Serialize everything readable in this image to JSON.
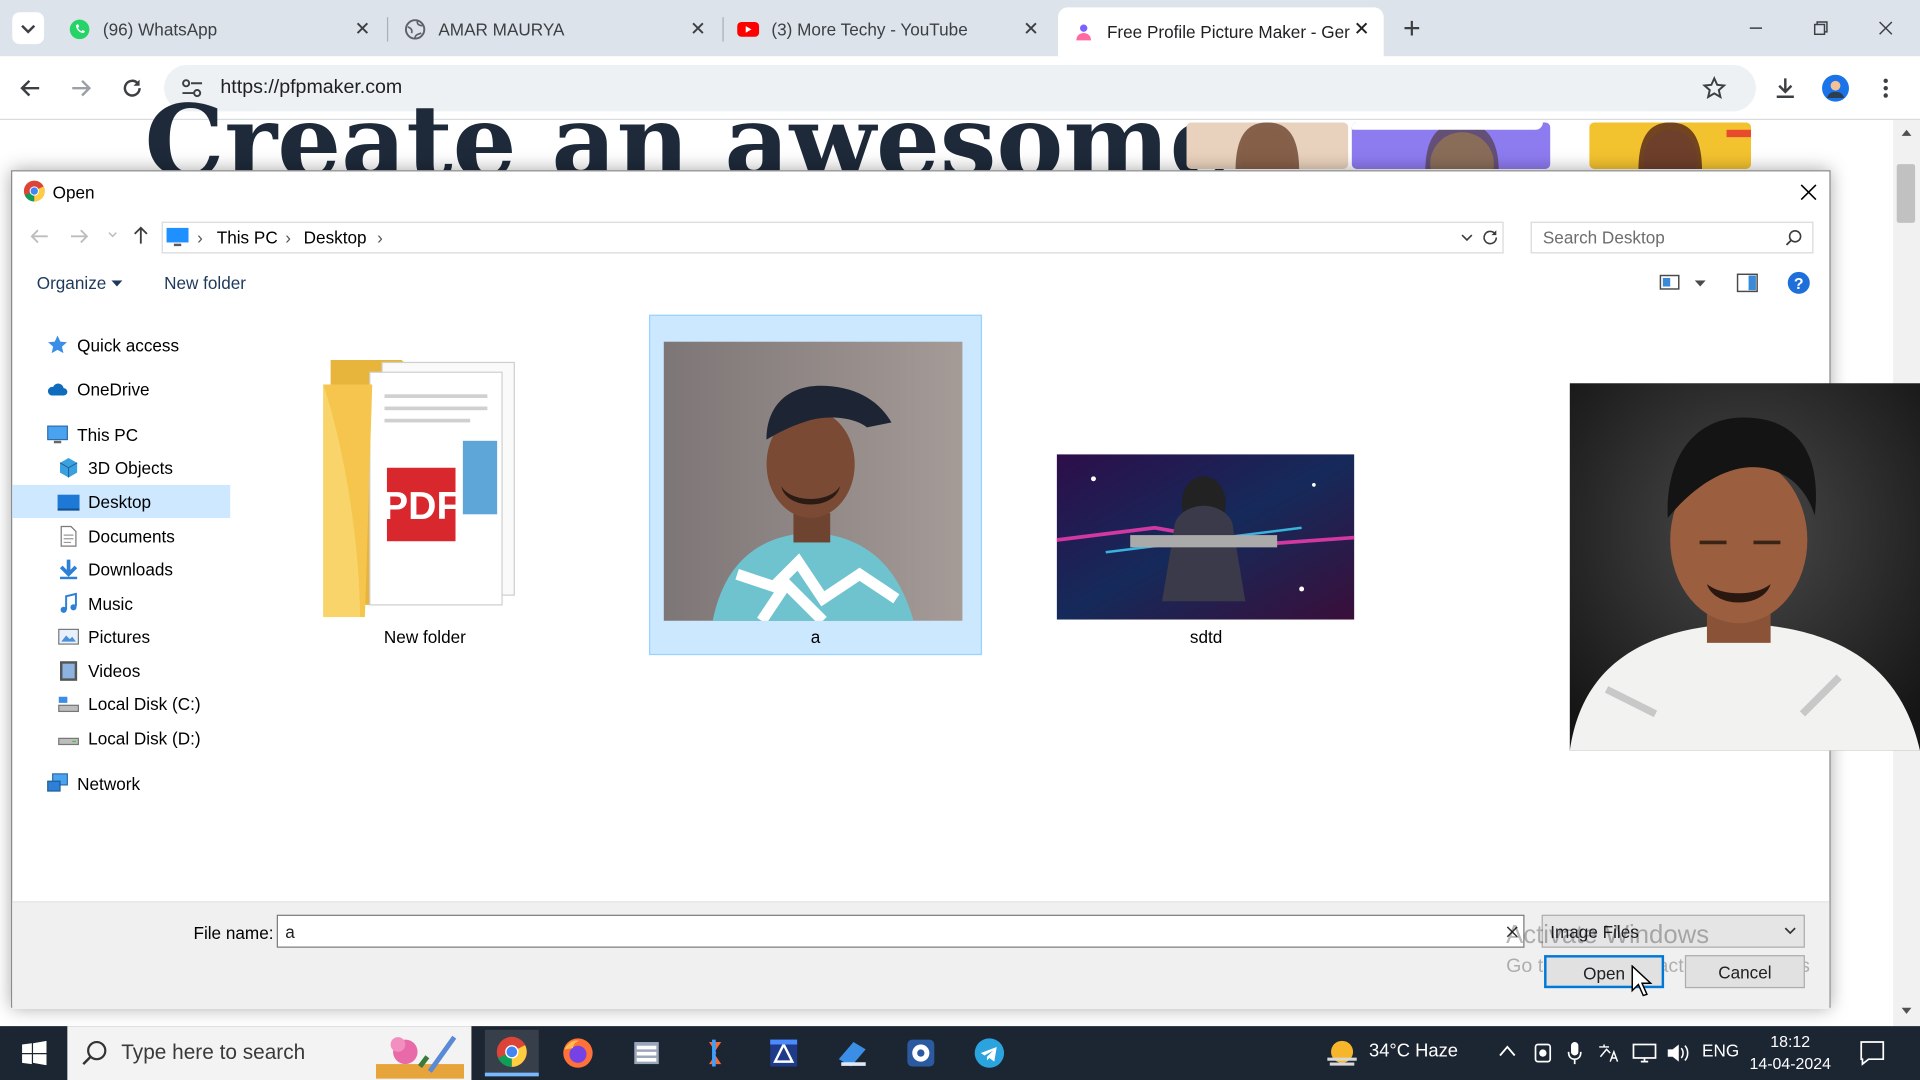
{
  "browser": {
    "tabs": [
      {
        "title": "(96) WhatsApp",
        "icon": "whatsapp-icon"
      },
      {
        "title": "AMAR MAURYA",
        "icon": "globe-icon"
      },
      {
        "title": "(3) More Techy - YouTube",
        "icon": "youtube-icon"
      },
      {
        "title": "Free Profile Picture Maker - Ger",
        "icon": "pfpmaker-icon",
        "active": true
      }
    ],
    "url": "https://pfpmaker.com",
    "accent": "#1a73e8"
  },
  "page": {
    "hero_text": "Create an awesome"
  },
  "dialog": {
    "title": "Open",
    "breadcrumb": [
      "This PC",
      "Desktop"
    ],
    "search_placeholder": "Search Desktop",
    "organize_label": "Organize",
    "new_folder_label": "New folder",
    "nav": [
      {
        "label": "Quick access",
        "icon": "star-icon"
      },
      {
        "label": "OneDrive",
        "icon": "cloud-icon"
      },
      {
        "label": "This PC",
        "icon": "computer-icon"
      },
      {
        "label": "3D Objects",
        "icon": "cube-icon"
      },
      {
        "label": "Desktop",
        "icon": "desktop-icon",
        "selected": true
      },
      {
        "label": "Documents",
        "icon": "document-icon"
      },
      {
        "label": "Downloads",
        "icon": "download-icon"
      },
      {
        "label": "Music",
        "icon": "music-icon"
      },
      {
        "label": "Pictures",
        "icon": "pictures-icon"
      },
      {
        "label": "Videos",
        "icon": "video-icon"
      },
      {
        "label": "Local Disk (C:)",
        "icon": "drive-icon"
      },
      {
        "label": "Local Disk (D:)",
        "icon": "drive-icon"
      },
      {
        "label": "Network",
        "icon": "network-icon"
      }
    ],
    "files": [
      {
        "name": "New folder",
        "type": "folder"
      },
      {
        "name": "a",
        "type": "image",
        "selected": true
      },
      {
        "name": "sdtd",
        "type": "image"
      }
    ],
    "file_name_label": "File name:",
    "file_name_value": "a",
    "file_type": "Image Files",
    "open_label": "Open",
    "cancel_label": "Cancel",
    "watermark_line1": "Activate Windows",
    "watermark_line2": "Go to Settings to activate Windows"
  },
  "taskbar": {
    "search_placeholder": "Type here to search",
    "weather": "34°C  Haze",
    "language": "ENG",
    "time": "18:12",
    "date": "14-04-2024"
  }
}
